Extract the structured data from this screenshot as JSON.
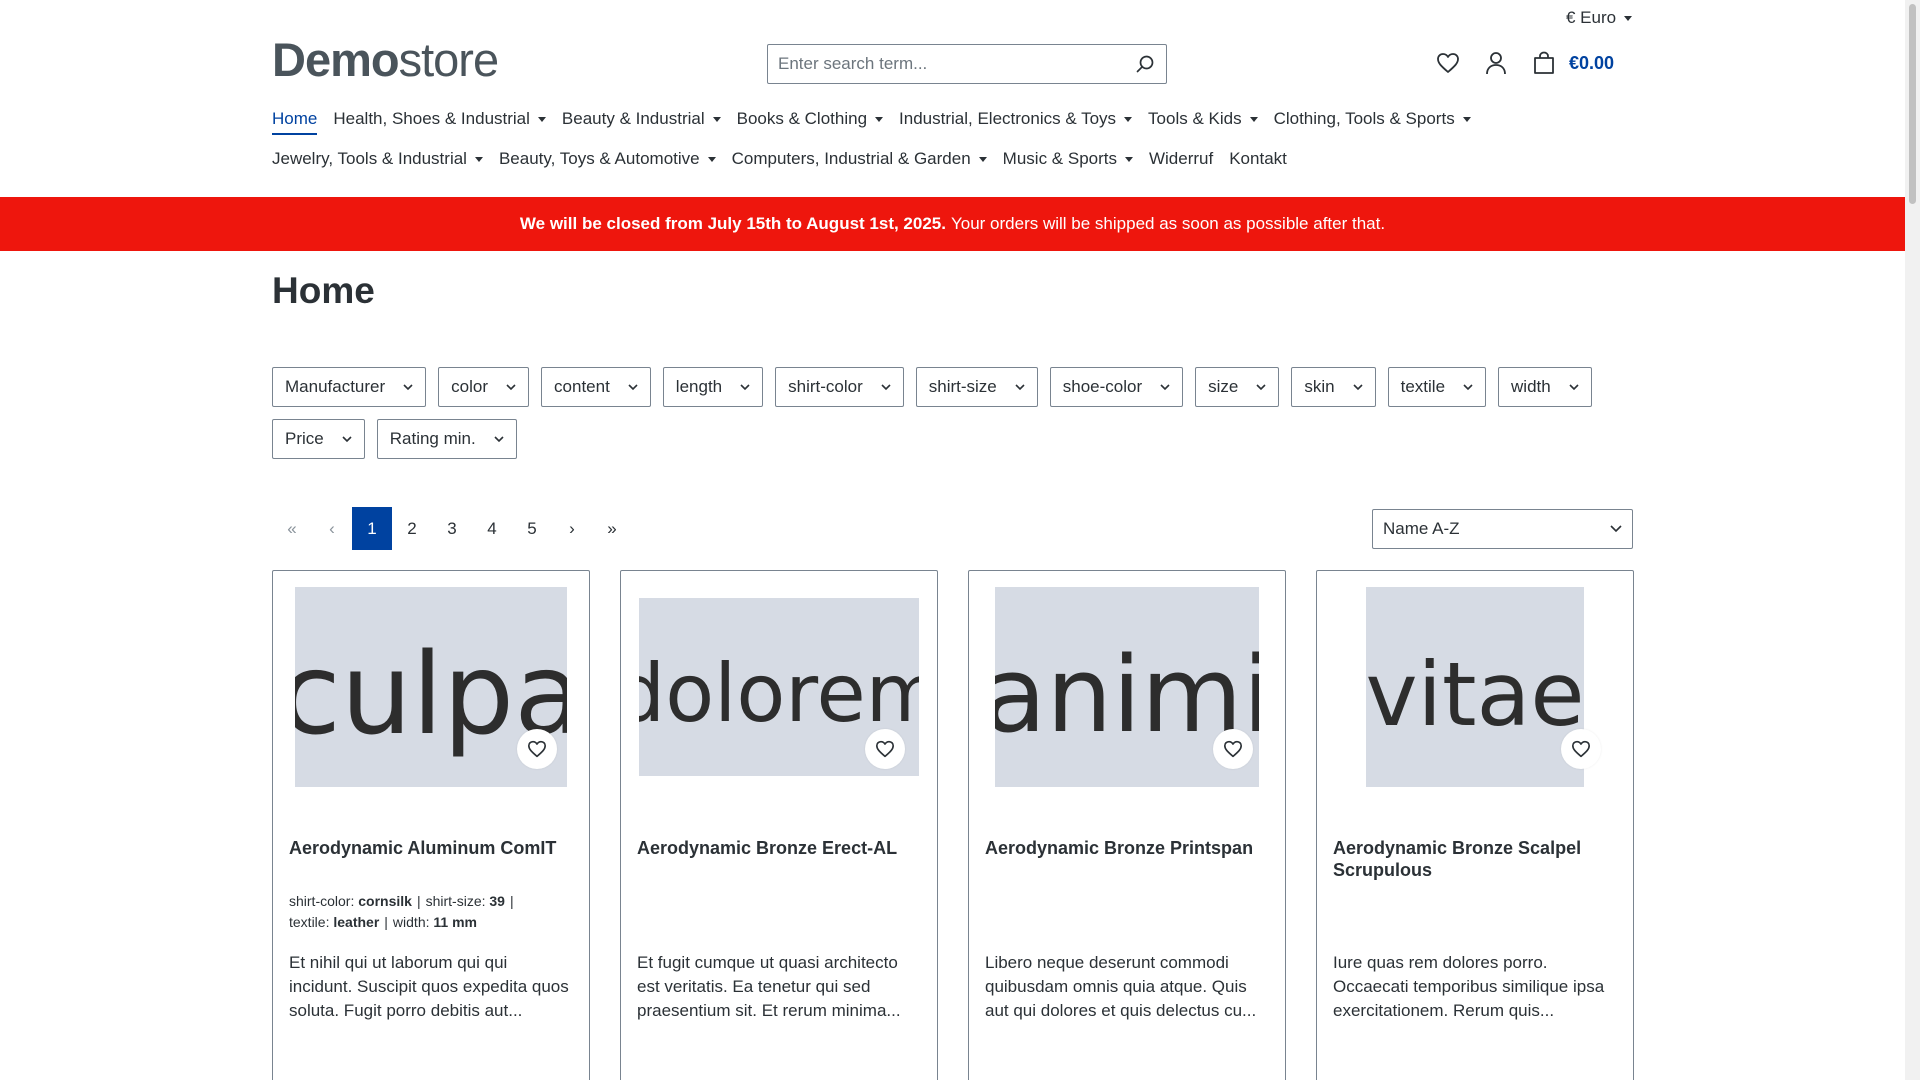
{
  "header": {
    "currency": "€ Euro",
    "logo_bold": "Demo",
    "logo_light": "store",
    "search_placeholder": "Enter search term...",
    "cart_total": "€0.00"
  },
  "nav": {
    "row1": [
      {
        "label": "Home",
        "active": true,
        "dropdown": false
      },
      {
        "label": "Health, Shoes & Industrial",
        "dropdown": true
      },
      {
        "label": "Beauty & Industrial",
        "dropdown": true
      },
      {
        "label": "Books & Clothing",
        "dropdown": true
      },
      {
        "label": "Industrial, Electronics & Toys",
        "dropdown": true
      },
      {
        "label": "Tools & Kids",
        "dropdown": true
      },
      {
        "label": "Clothing, Tools & Sports",
        "dropdown": true
      }
    ],
    "row2": [
      {
        "label": "Jewelry, Tools & Industrial",
        "dropdown": true
      },
      {
        "label": "Beauty, Toys & Automotive",
        "dropdown": true
      },
      {
        "label": "Computers, Industrial & Garden",
        "dropdown": true
      },
      {
        "label": "Music & Sports",
        "dropdown": true
      },
      {
        "label": "Widerruf",
        "dropdown": false
      },
      {
        "label": "Kontakt",
        "dropdown": false
      }
    ]
  },
  "banner": {
    "bold": "We will be closed from July 15th to August 1st, 2025.",
    "text": "Your orders will be shipped as soon as possible after that.",
    "color": "#ee160d"
  },
  "page_title": "Home",
  "filters": [
    "Manufacturer",
    "color",
    "content",
    "length",
    "shirt-color",
    "shirt-size",
    "shoe-color",
    "size",
    "skin",
    "textile",
    "width",
    "Price",
    "Rating min."
  ],
  "pagination": {
    "first": "«",
    "prev": "‹",
    "pages": [
      "1",
      "2",
      "3",
      "4",
      "5"
    ],
    "current": "1",
    "next": "›",
    "last": "»"
  },
  "sort": {
    "selected": "Name A-Z"
  },
  "products": [
    {
      "image_text": "culpa",
      "name": "Aerodynamic Aluminum ComIT",
      "props": [
        {
          "label": "shirt-color:",
          "value": "cornsilk"
        },
        {
          "label": "shirt-size:",
          "value": "39"
        },
        {
          "label": "textile:",
          "value": "leather"
        },
        {
          "label": "width:",
          "value": "11 mm"
        }
      ],
      "description": "Et nihil qui ut laborum qui qui incidunt. Suscipit quos expedita quos soluta. Fugit porro debitis aut..."
    },
    {
      "image_text": "dolorem",
      "name": "Aerodynamic Bronze Erect-AL",
      "props": [],
      "description": "Et fugit cumque ut quasi architecto est veritatis. Ea tenetur qui sed praesentium sit. Et rerum minima..."
    },
    {
      "image_text": "animi",
      "name": "Aerodynamic Bronze Printspan",
      "props": [],
      "description": "Libero neque deserunt commodi quibusdam omnis quia atque. Quis aut qui dolores et quis delectus cu..."
    },
    {
      "image_text": "vitae",
      "name": "Aerodynamic Bronze Scalpel Scrupulous",
      "props": [],
      "description": "Iure quas rem dolores porro. Occaecati temporibus similique ipsa exercitationem. Rerum quis..."
    }
  ],
  "colors": {
    "primary": "#0042a0",
    "text": "#2b3136",
    "border": "#798490",
    "image_bg": "#d6dbe4"
  }
}
